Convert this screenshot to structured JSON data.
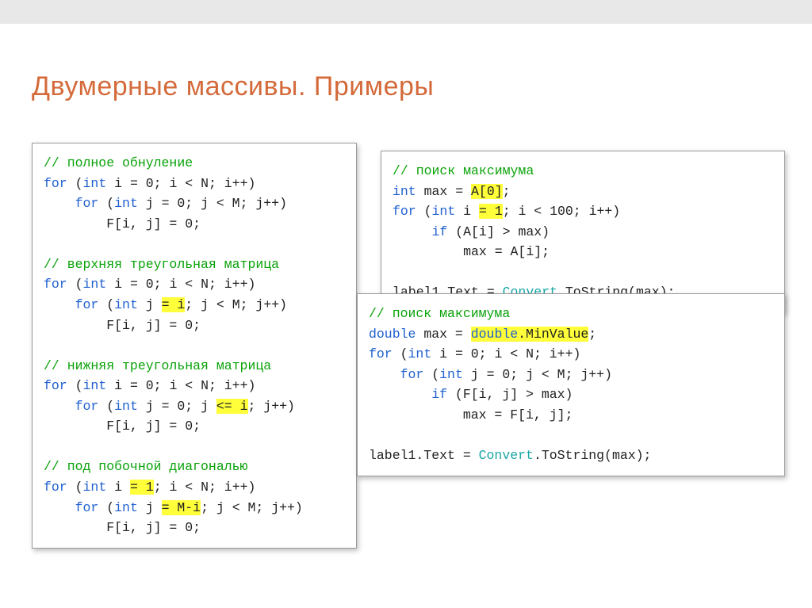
{
  "title": "Двумерные массивы. Примеры",
  "box1": {
    "c1": "// полное обнуление",
    "l1a": "for",
    "l1b": "int",
    "l1c": " i = 0; i < N; i++)",
    "l2a": "for",
    "l2b": "int",
    "l2c": " j = 0; j < M; j++)",
    "l3": "        F[i, j] = 0;",
    "c2": "// верхняя треугольная матрица",
    "l4a": "for",
    "l4b": "int",
    "l4c": " i = 0; i < N; i++)",
    "l5a": "for",
    "l5b": "int",
    "l5c": " j ",
    "l5hl": "= i",
    "l5d": "; j < M; j++)",
    "l6": "        F[i, j] = 0;",
    "c3": "// нижняя треугольная матрица",
    "l7a": "for",
    "l7b": "int",
    "l7c": " i = 0; i < N; i++)",
    "l8a": "for",
    "l8b": "int",
    "l8c": " j = 0; j ",
    "l8hl": "<= i",
    "l8d": "; j++)",
    "l9": "        F[i, j] = 0;",
    "c4": "// под побочной диагональю",
    "l10a": "for",
    "l10b": "int",
    "l10c": " i ",
    "l10hl": "= 1",
    "l10d": "; i < N; i++)",
    "l11a": "for",
    "l11b": "int",
    "l11c": " j ",
    "l11hl": "= M-i",
    "l11d": "; j < M; j++)",
    "l12": "        F[i, j] = 0;"
  },
  "box2": {
    "c1": "// поиск максимума",
    "l1a": "int",
    "l1b": " max = ",
    "l1hl": "A[0]",
    "l1c": ";",
    "l2a": "for",
    "l2b": "int",
    "l2c": " i ",
    "l2hl": "= 1",
    "l2d": "; i < 100; i++)",
    "l3a": "if",
    "l3b": " (A[i] > max)",
    "l4": "         max = A[i];",
    "l5a": "label1.Text = ",
    "l5b": "Convert",
    "l5c": ".ToString(max);"
  },
  "box3": {
    "c1": "// поиск максимума",
    "l1a": "double",
    "l1b": " max = ",
    "l1c": "double",
    "l1hl": ".MinValue",
    "l1d": ";",
    "l2a": "for",
    "l2b": "int",
    "l2c": " i = 0; i < N; i++)",
    "l3a": "for",
    "l3b": "int",
    "l3c": " j = 0; j < M; j++)",
    "l4a": "if",
    "l4b": " (F[i, j] > max)",
    "l5": "            max = F[i, j];",
    "l6a": "label1.Text = ",
    "l6b": "Convert",
    "l6c": ".ToString(max);"
  }
}
